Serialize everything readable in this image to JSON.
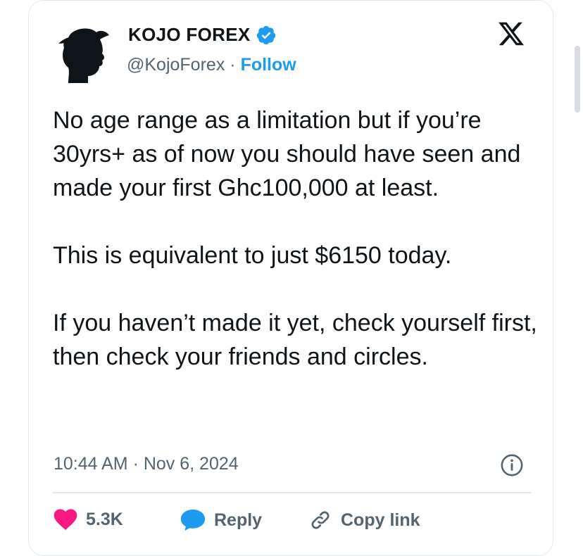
{
  "author": {
    "name": "KOJO FOREX",
    "handle": "@KojoForex",
    "separator": "·",
    "follow_label": "Follow",
    "verified": true
  },
  "platform_icon": "x-logo-icon",
  "tweet": {
    "paragraphs": [
      "No age range as a limitation but if you’re 30yrs+ as of now you should have seen and made your first Ghc100,000 at least.",
      "This is equivalent to just $6150 today.",
      "If you haven’t made it yet, check yourself first, then check your friends and circles."
    ]
  },
  "timestamp": "10:44 AM · Nov 6, 2024",
  "actions": {
    "like_count": "5.3K",
    "reply_label": "Reply",
    "copy_link_label": "Copy link"
  },
  "colors": {
    "accent": "#1d9bf0",
    "like": "#f91880",
    "muted": "#536471",
    "text": "#0f1419",
    "border": "#e1e8ed"
  }
}
